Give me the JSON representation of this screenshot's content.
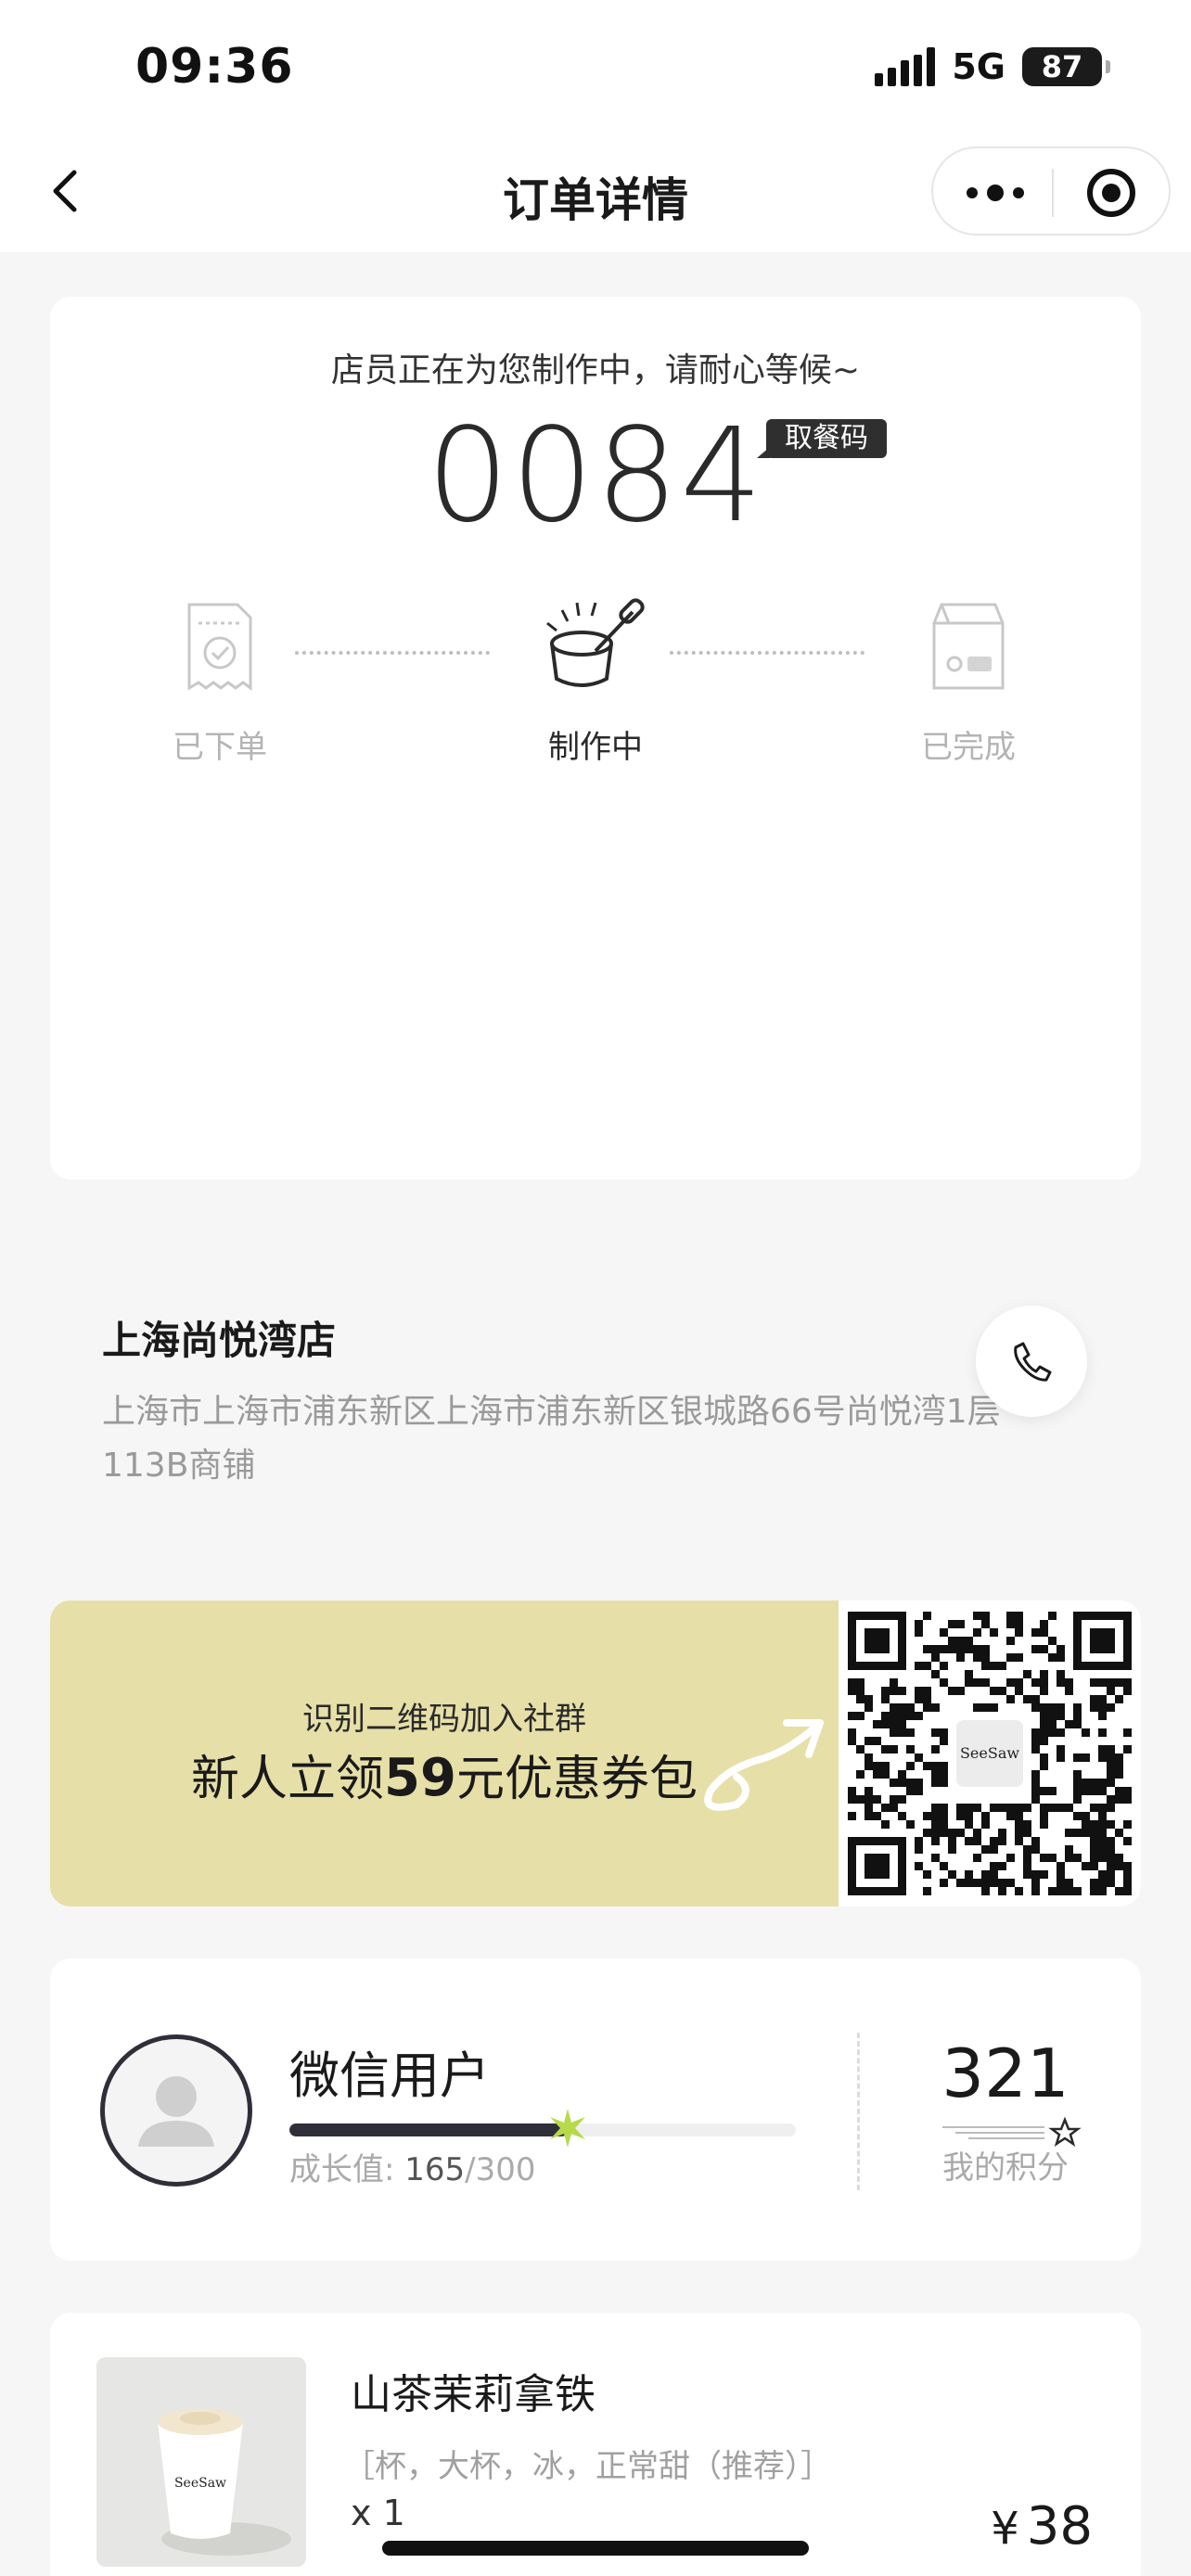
{
  "status_bar": {
    "time": "09:36",
    "network": "5G",
    "battery": "87"
  },
  "nav": {
    "title": "订单详情"
  },
  "order_status": {
    "message": "店员正在为您制作中，请耐心等候~",
    "pickup_code": "0084",
    "pickup_label": "取餐码",
    "steps": [
      {
        "label": "已下单",
        "active": false
      },
      {
        "label": "制作中",
        "active": true
      },
      {
        "label": "已完成",
        "active": false
      }
    ]
  },
  "store": {
    "name": "上海尚悦湾店",
    "address": "上海市上海市浦东新区上海市浦东新区银城路66号尚悦湾1层113B商铺"
  },
  "promo": {
    "subtitle": "识别二维码加入社群",
    "title_prefix": "新人立领",
    "title_number": "59",
    "title_suffix": "元优惠券包"
  },
  "member": {
    "name": "微信用户",
    "growth_label": "成长值: ",
    "growth_current": "165",
    "growth_total": "/300",
    "growth_fraction": 0.55,
    "points": "321",
    "points_label": "我的积分"
  },
  "order_item": {
    "name": "山茶茉莉拿铁",
    "spec": "［杯，大杯，冰，正常甜（推荐）］",
    "quantity": "x 1",
    "currency": "¥",
    "price": "38"
  },
  "icons": {
    "back": "chevron-left-icon",
    "more": "more-dots-icon",
    "close": "target-close-icon",
    "phone": "phone-icon",
    "receipt": "receipt-check-icon",
    "making": "cup-making-icon",
    "bag": "bag-done-icon",
    "avatar": "user-avatar-icon"
  }
}
